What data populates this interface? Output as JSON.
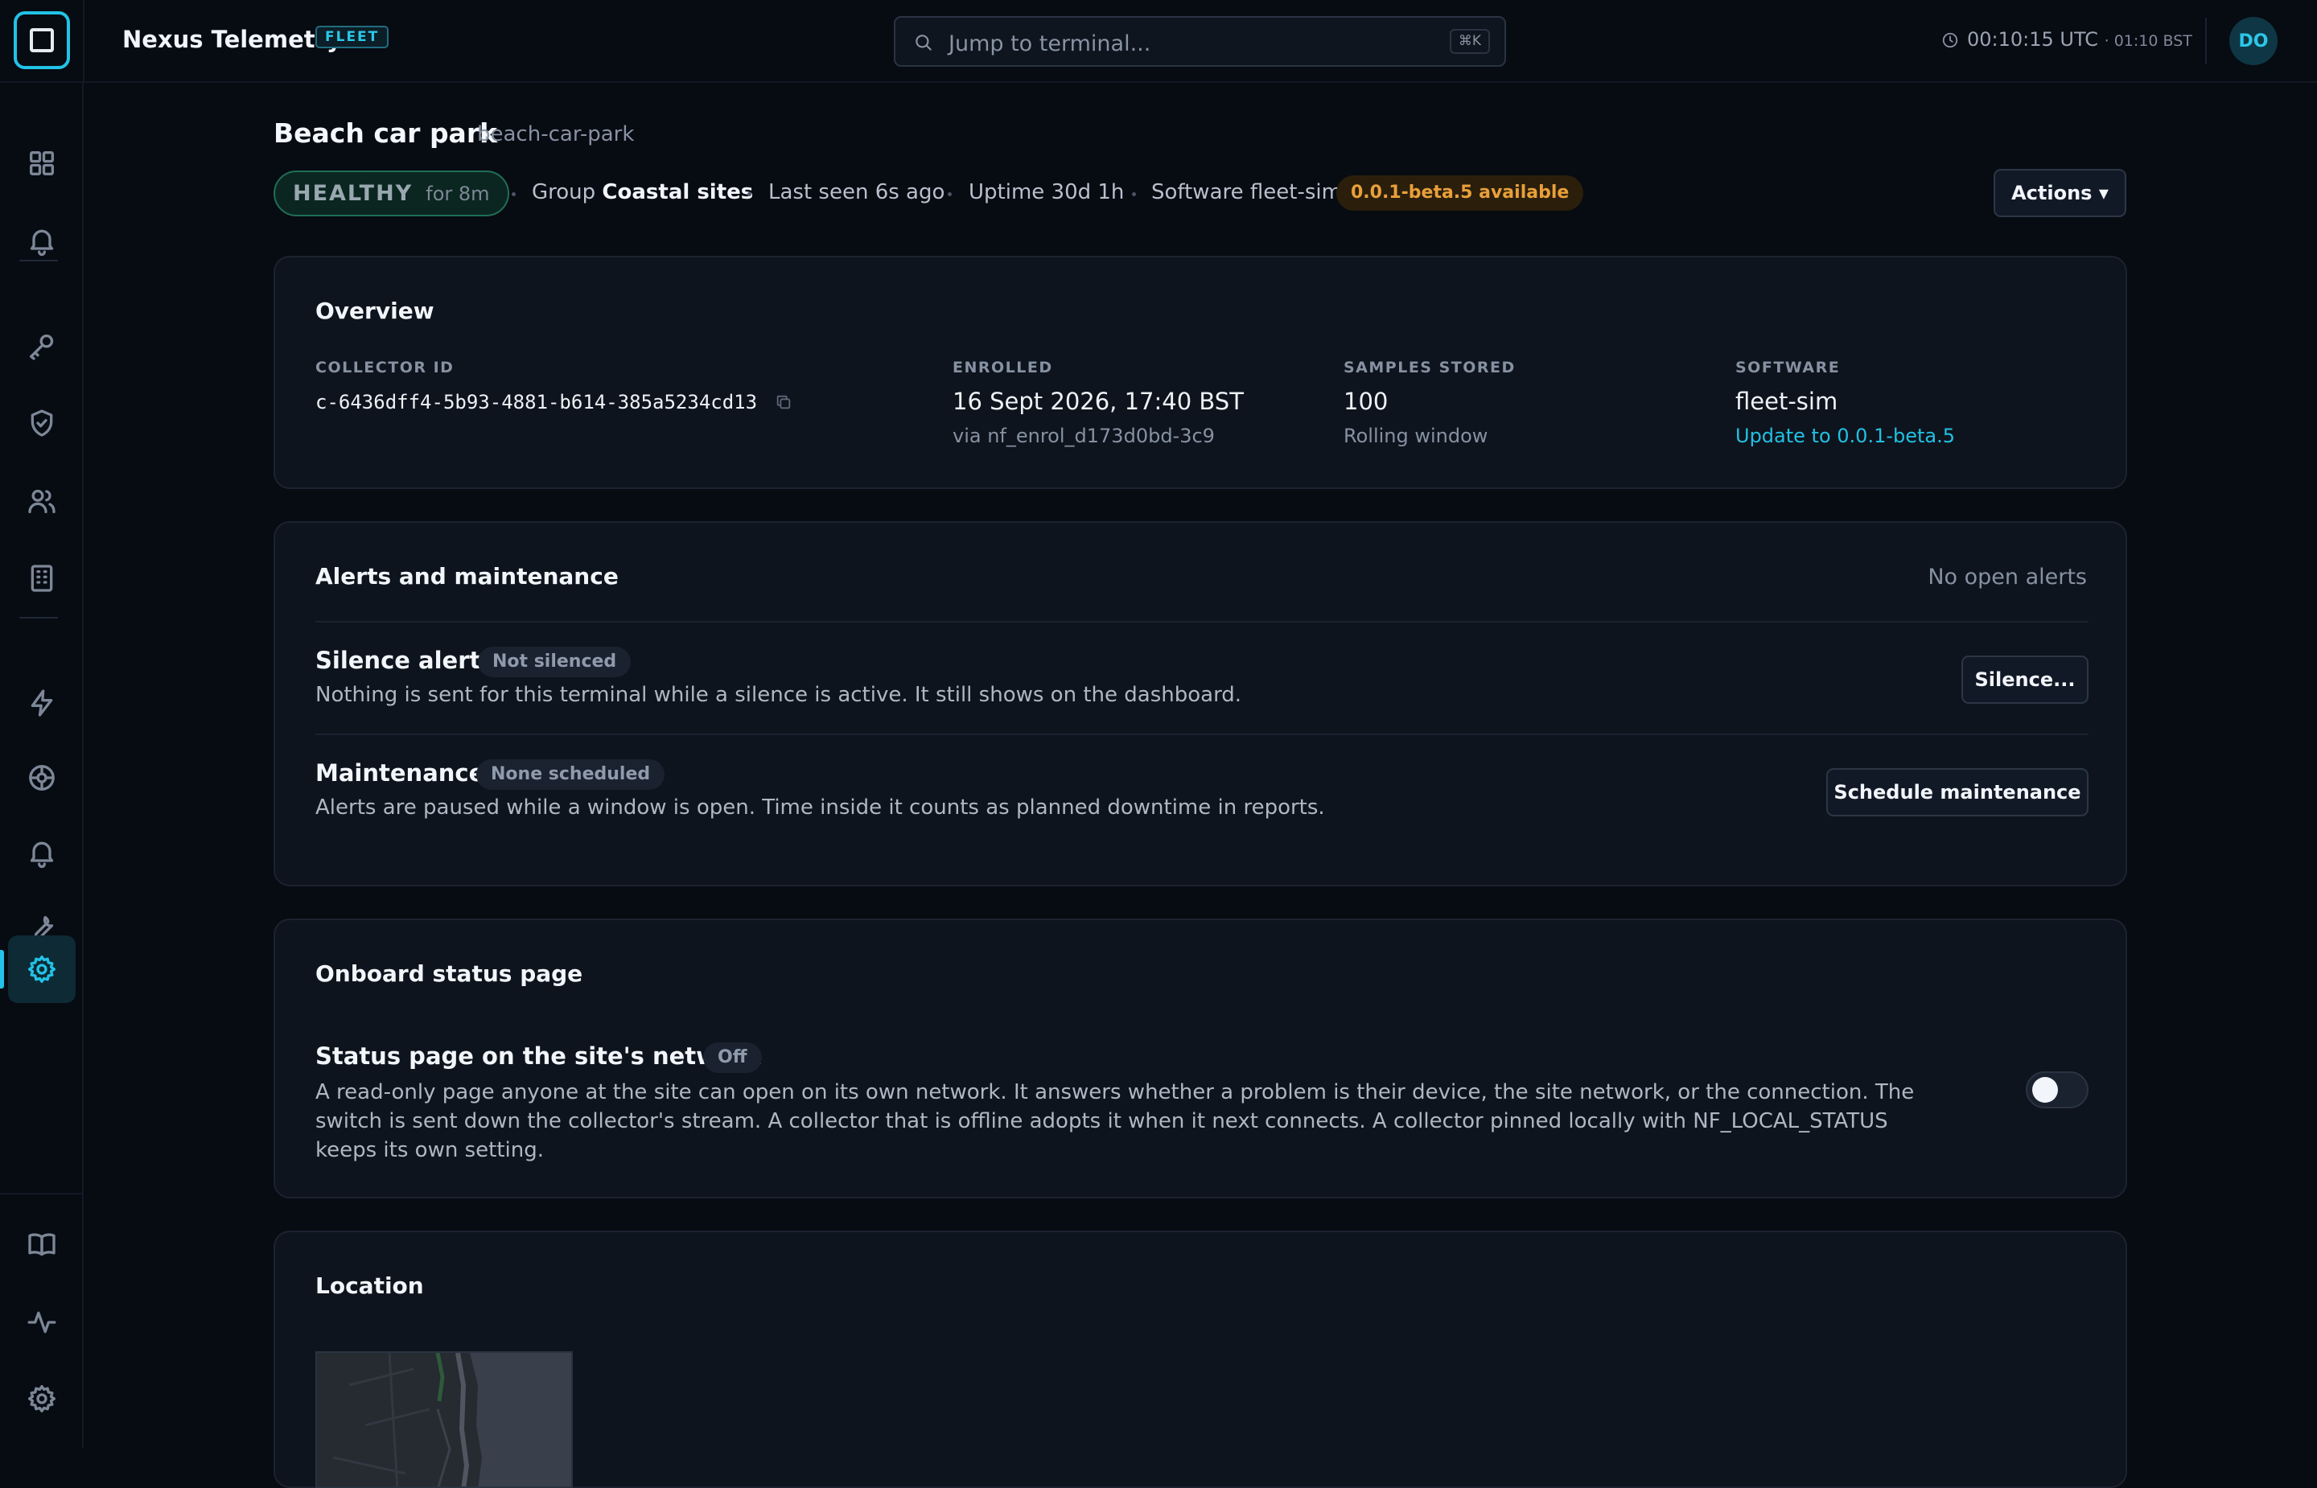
{
  "app": {
    "title": "Nexus Telemetry",
    "badge": "FLEET",
    "accent_color": "#22c3e6"
  },
  "search": {
    "placeholder": "Jump to terminal...",
    "shortcut": "⌘K"
  },
  "clock": {
    "utc": "00:10:15 UTC",
    "local": "· 01:10 BST"
  },
  "user": {
    "initials": "DO"
  },
  "sidebar": {
    "items": [
      {
        "name": "dashboard-grid-icon"
      },
      {
        "name": "bell-icon"
      },
      {
        "name": "key-icon"
      },
      {
        "name": "shield-check-icon"
      },
      {
        "name": "users-icon"
      },
      {
        "name": "building-icon"
      },
      {
        "name": "lightning-icon"
      },
      {
        "name": "globe-target-icon"
      },
      {
        "name": "bell-icon"
      },
      {
        "name": "wrench-icon"
      },
      {
        "name": "gear-icon",
        "active": true
      },
      {
        "name": "book-open-icon"
      },
      {
        "name": "activity-pulse-icon"
      },
      {
        "name": "gear-icon"
      }
    ]
  },
  "page": {
    "title": "Beach car park",
    "slug": "beach-car-park",
    "health": "HEALTHY",
    "health_duration": "for 8m",
    "group_label": "Group",
    "group_value": "Coastal sites",
    "last_seen": "Last seen 6s ago",
    "uptime": "Uptime 30d 1h",
    "software": "Software fleet-sim",
    "update_badge": "0.0.1-beta.5 available",
    "actions_label": "Actions ▾"
  },
  "overview": {
    "title": "Overview",
    "collector_label": "COLLECTOR ID",
    "collector_id": "c-6436dff4-5b93-4881-b614-385a5234cd13",
    "enrolled_label": "ENROLLED",
    "enrolled_value": "16 Sept 2026, 17:40 BST",
    "enrolled_sub": "via nf_enrol_d173d0bd-3c9",
    "samples_label": "SAMPLES STORED",
    "samples_value": "100",
    "samples_sub": "Rolling window",
    "software_label": "SOFTWARE",
    "software_value": "fleet-sim",
    "software_link": "Update to 0.0.1-beta.5"
  },
  "alerts": {
    "title": "Alerts and maintenance",
    "status": "No open alerts",
    "silence_title": "Silence alerts",
    "silence_badge": "Not silenced",
    "silence_desc": "Nothing is sent for this terminal while a silence is active. It still shows on the dashboard.",
    "silence_button": "Silence...",
    "maint_title": "Maintenance",
    "maint_badge": "None scheduled",
    "maint_desc": "Alerts are paused while a window is open. Time inside it counts as planned downtime in reports.",
    "maint_button": "Schedule maintenance"
  },
  "status_page": {
    "title": "Onboard status page",
    "setting_title": "Status page on the site's network",
    "badge": "Off",
    "desc": "A read-only page anyone at the site can open on its own network. It answers whether a problem is their device, the site network, or the connection. The switch is sent down the collector's stream. A collector that is offline adopts it when it next connects. A collector pinned locally with NF_LOCAL_STATUS keeps its own setting.",
    "enabled": false
  },
  "location": {
    "title": "Location"
  }
}
